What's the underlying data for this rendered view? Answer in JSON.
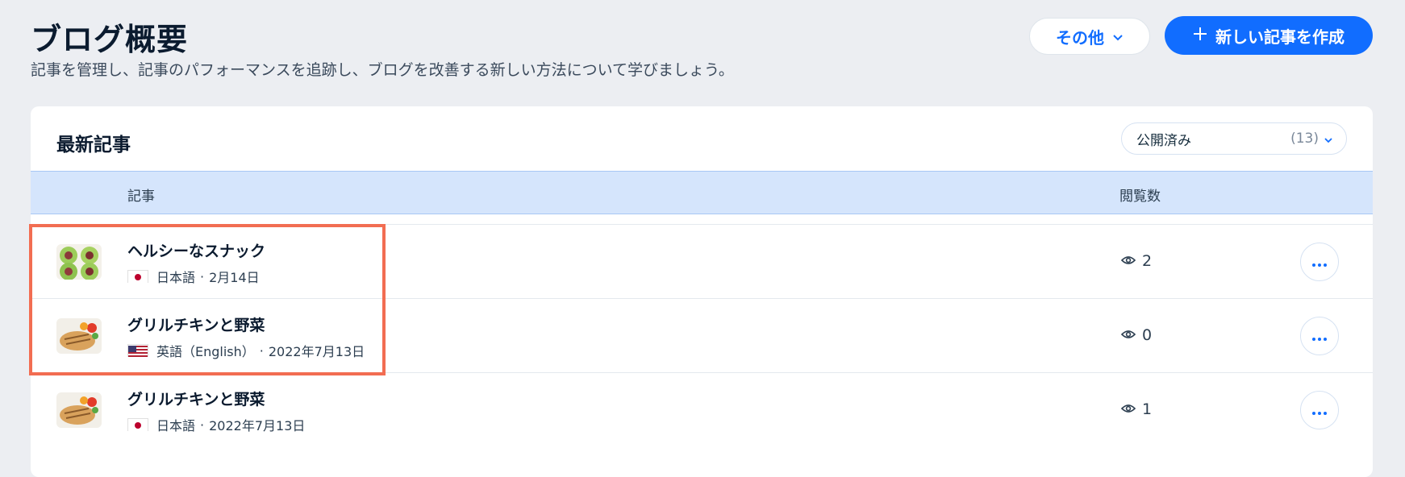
{
  "header": {
    "title": "ブログ概要",
    "subtitle": "記事を管理し、記事のパフォーマンスを追跡し、ブログを改善する新しい方法について学びましょう。",
    "more_label": "その他",
    "create_label": "新しい記事を作成"
  },
  "card": {
    "title": "最新記事",
    "filter_label": "公開済み",
    "filter_count": "(13)",
    "columns": {
      "post": "記事",
      "views": "閲覧数"
    }
  },
  "posts": [
    {
      "title": "ヘルシーなスナック",
      "language": "日本語",
      "date": "2月14日",
      "views": "2",
      "flag": "jp"
    },
    {
      "title": "グリルチキンと野菜",
      "language": "英語（English）",
      "date": "2022年7月13日",
      "views": "0",
      "flag": "us"
    },
    {
      "title": "グリルチキンと野菜",
      "language": "日本語",
      "date": "2022年7月13日",
      "views": "1",
      "flag": "jp"
    }
  ],
  "separator": "·",
  "colors": {
    "accent": "#116dff",
    "highlight": "#f26d52",
    "header_bg": "#d5e5fc"
  },
  "icons": {
    "more": "chevron-down-icon",
    "create": "plus-icon",
    "views": "eye-icon",
    "row_actions": "ellipsis-icon"
  }
}
